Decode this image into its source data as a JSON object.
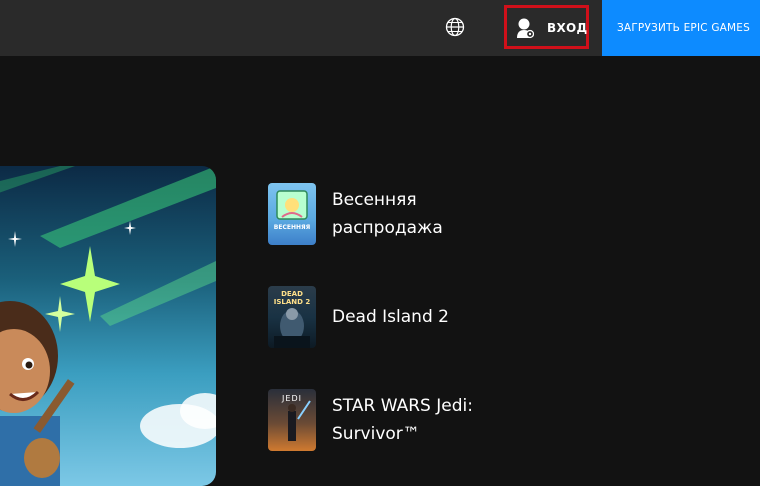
{
  "header": {
    "sign_in_label": "ВХОД",
    "download_label": "ЗАГРУЗИТЬ EPIC GAMES",
    "icons": {
      "language": "globe-icon",
      "user": "user-icon"
    }
  },
  "featured_list": [
    {
      "title": "Весенняя распродажа",
      "thumb_text": "ВЕСЕННЯЯ"
    },
    {
      "title": "Dead Island 2",
      "thumb_text": "DEAD ISLAND 2"
    },
    {
      "title": "STAR WARS Jedi: Survivor™",
      "thumb_text": "JEDI"
    }
  ],
  "colors": {
    "background": "#121212",
    "topbar": "#2a2a2a",
    "accent": "#0d8bff",
    "highlight_border": "#d0101a"
  }
}
